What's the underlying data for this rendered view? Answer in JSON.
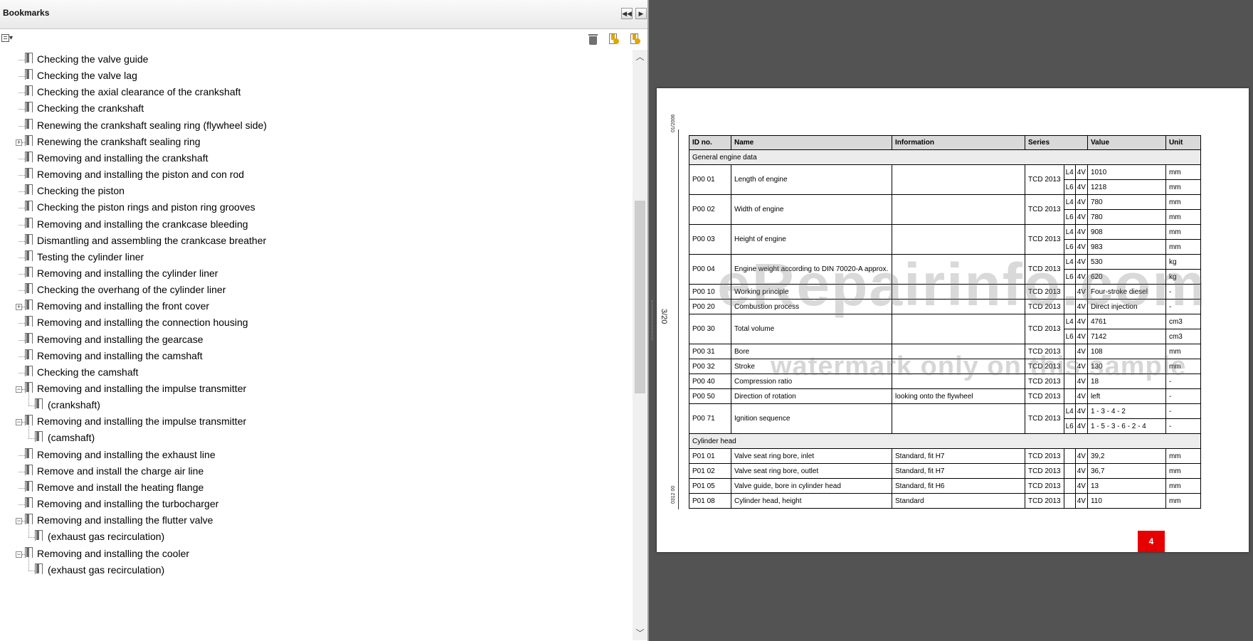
{
  "panel": {
    "title": "Bookmarks",
    "collapse_icon": "double-chevron-left-icon",
    "next_icon": "chevron-right-icon",
    "toolbar": {
      "options_icon": "options-menu-icon",
      "delete_icon": "trash-icon",
      "new_bookmark_icon": "new-bookmark-icon",
      "bookmark_properties_icon": "bookmark-properties-icon"
    },
    "bookmarks": [
      {
        "label": "Checking the valve guide",
        "expandable": false,
        "indent": 0
      },
      {
        "label": "Checking the valve lag",
        "expandable": false,
        "indent": 0
      },
      {
        "label": "Checking the axial clearance of the crankshaft",
        "expandable": false,
        "indent": 0
      },
      {
        "label": "Checking the crankshaft",
        "expandable": false,
        "indent": 0
      },
      {
        "label": "Renewing the crankshaft sealing ring (flywheel side)",
        "expandable": false,
        "indent": 0
      },
      {
        "label": "Renewing the crankshaft sealing ring",
        "expandable": true,
        "expanded": false,
        "indent": 0
      },
      {
        "label": "Removing and installing the crankshaft",
        "expandable": false,
        "indent": 0
      },
      {
        "label": "Removing and installing the piston and con rod",
        "expandable": false,
        "indent": 0
      },
      {
        "label": "Checking the piston",
        "expandable": false,
        "indent": 0
      },
      {
        "label": "Checking the piston rings and piston ring grooves",
        "expandable": false,
        "indent": 0
      },
      {
        "label": "Removing and installing the crankcase bleeding",
        "expandable": false,
        "indent": 0
      },
      {
        "label": "Dismantling and assembling the crankcase breather",
        "expandable": false,
        "indent": 0
      },
      {
        "label": "Testing the cylinder liner",
        "expandable": false,
        "indent": 0
      },
      {
        "label": "Removing and installing the cylinder liner",
        "expandable": false,
        "indent": 0
      },
      {
        "label": "Checking the overhang of the cylinder liner",
        "expandable": false,
        "indent": 0
      },
      {
        "label": "Removing and installing the front cover",
        "expandable": true,
        "expanded": false,
        "indent": 0
      },
      {
        "label": "Removing and installing the connection housing",
        "expandable": false,
        "indent": 0
      },
      {
        "label": "Removing and installing the gearcase",
        "expandable": false,
        "indent": 0
      },
      {
        "label": "Removing and installing the camshaft",
        "expandable": false,
        "indent": 0
      },
      {
        "label": "Checking the camshaft",
        "expandable": false,
        "indent": 0
      },
      {
        "label": "Removing and installing the impulse transmitter",
        "expandable": true,
        "expanded": true,
        "indent": 0
      },
      {
        "label": "(crankshaft)",
        "expandable": false,
        "indent": 1
      },
      {
        "label": "Removing and installing the impulse transmitter",
        "expandable": true,
        "expanded": true,
        "indent": 0
      },
      {
        "label": "(camshaft)",
        "expandable": false,
        "indent": 1
      },
      {
        "label": "Removing and installing the exhaust line",
        "expandable": false,
        "indent": 0
      },
      {
        "label": "Remove and install the charge air line",
        "expandable": false,
        "indent": 0
      },
      {
        "label": "Remove and install the heating flange",
        "expandable": false,
        "indent": 0
      },
      {
        "label": "Removing and installing the turbocharger",
        "expandable": false,
        "indent": 0
      },
      {
        "label": "Removing and installing the flutter valve",
        "expandable": true,
        "expanded": true,
        "indent": 0
      },
      {
        "label": "(exhaust gas recirculation)",
        "expandable": false,
        "indent": 1
      },
      {
        "label": "Removing and installing the cooler",
        "expandable": true,
        "expanded": true,
        "indent": 0
      },
      {
        "label": "(exhaust gas recirculation)",
        "expandable": false,
        "indent": 1
      }
    ]
  },
  "document": {
    "side_code_top": "01/2006",
    "side_page_number": "3/20",
    "side_code_bottom": "0312 00",
    "watermark_main": "eRepairinfo.com",
    "watermark_sub": "watermark only on this sample",
    "page_marker": "4",
    "table": {
      "headers": [
        "ID no.",
        "Name",
        "Information",
        "Series",
        "Value",
        "Unit"
      ],
      "sections": [
        {
          "title": "General engine data",
          "rows": [
            {
              "id": "P00 01",
              "name": "Length of engine",
              "info": "",
              "series": "TCD 2013",
              "variants": [
                {
                  "cyl": "L4",
                  "valves": "4V",
                  "value": "1010",
                  "unit": "mm"
                },
                {
                  "cyl": "L6",
                  "valves": "4V",
                  "value": "1218",
                  "unit": "mm"
                }
              ]
            },
            {
              "id": "P00 02",
              "name": "Width of engine",
              "info": "",
              "series": "TCD 2013",
              "variants": [
                {
                  "cyl": "L4",
                  "valves": "4V",
                  "value": "780",
                  "unit": "mm"
                },
                {
                  "cyl": "L6",
                  "valves": "4V",
                  "value": "780",
                  "unit": "mm"
                }
              ]
            },
            {
              "id": "P00 03",
              "name": "Height of engine",
              "info": "",
              "series": "TCD 2013",
              "variants": [
                {
                  "cyl": "L4",
                  "valves": "4V",
                  "value": "908",
                  "unit": "mm"
                },
                {
                  "cyl": "L6",
                  "valves": "4V",
                  "value": "983",
                  "unit": "mm"
                }
              ]
            },
            {
              "id": "P00 04",
              "name": "Engine weight according to DIN 70020-A approx.",
              "info": "",
              "series": "TCD 2013",
              "variants": [
                {
                  "cyl": "L4",
                  "valves": "4V",
                  "value": "530",
                  "unit": "kg"
                },
                {
                  "cyl": "L6",
                  "valves": "4V",
                  "value": "620",
                  "unit": "kg"
                }
              ]
            },
            {
              "id": "P00 10",
              "name": "Working principle",
              "info": "",
              "series": "TCD 2013",
              "variants": [
                {
                  "cyl": "",
                  "valves": "4V",
                  "value": "Four-stroke diesel",
                  "unit": "-"
                }
              ]
            },
            {
              "id": "P00 20",
              "name": "Combustion process",
              "info": "",
              "series": "TCD 2013",
              "variants": [
                {
                  "cyl": "",
                  "valves": "4V",
                  "value": "Direct injection",
                  "unit": "-"
                }
              ]
            },
            {
              "id": "P00 30",
              "name": "Total volume",
              "info": "",
              "series": "TCD 2013",
              "variants": [
                {
                  "cyl": "L4",
                  "valves": "4V",
                  "value": "4761",
                  "unit": "cm3"
                },
                {
                  "cyl": "L6",
                  "valves": "4V",
                  "value": "7142",
                  "unit": "cm3"
                }
              ]
            },
            {
              "id": "P00 31",
              "name": "Bore",
              "info": "",
              "series": "TCD 2013",
              "variants": [
                {
                  "cyl": "",
                  "valves": "4V",
                  "value": "108",
                  "unit": "mm"
                }
              ]
            },
            {
              "id": "P00 32",
              "name": "Stroke",
              "info": "",
              "series": "TCD 2013",
              "variants": [
                {
                  "cyl": "",
                  "valves": "4V",
                  "value": "130",
                  "unit": "mm"
                }
              ]
            },
            {
              "id": "P00 40",
              "name": "Compression ratio",
              "info": "",
              "series": "TCD 2013",
              "variants": [
                {
                  "cyl": "",
                  "valves": "4V",
                  "value": "18",
                  "unit": "-"
                }
              ]
            },
            {
              "id": "P00 50",
              "name": "Direction of rotation",
              "info": "looking onto the flywheel",
              "series": "TCD 2013",
              "variants": [
                {
                  "cyl": "",
                  "valves": "4V",
                  "value": "left",
                  "unit": "-"
                }
              ]
            },
            {
              "id": "P00 71",
              "name": "Ignition sequence",
              "info": "",
              "series": "TCD 2013",
              "variants": [
                {
                  "cyl": "L4",
                  "valves": "4V",
                  "value": "1 - 3 - 4 - 2",
                  "unit": "-"
                },
                {
                  "cyl": "L6",
                  "valves": "4V",
                  "value": "1 - 5 - 3 - 6 - 2 - 4",
                  "unit": "-"
                }
              ]
            }
          ]
        },
        {
          "title": "Cylinder head",
          "rows": [
            {
              "id": "P01 01",
              "name": "Valve seat ring bore, inlet",
              "info": "Standard, fit H7",
              "series": "TCD 2013",
              "variants": [
                {
                  "cyl": "",
                  "valves": "4V",
                  "value": "39,2",
                  "unit": "mm"
                }
              ]
            },
            {
              "id": "P01 02",
              "name": "Valve seat ring bore, outlet",
              "info": "Standard, fit H7",
              "series": "TCD 2013",
              "variants": [
                {
                  "cyl": "",
                  "valves": "4V",
                  "value": "36,7",
                  "unit": "mm"
                }
              ]
            },
            {
              "id": "P01 05",
              "name": "Valve guide, bore in cylinder head",
              "info": "Standard, fit H6",
              "series": "TCD 2013",
              "variants": [
                {
                  "cyl": "",
                  "valves": "4V",
                  "value": "13",
                  "unit": "mm"
                }
              ]
            },
            {
              "id": "P01 08",
              "name": "Cylinder head, height",
              "info": "Standard",
              "series": "TCD 2013",
              "variants": [
                {
                  "cyl": "",
                  "valves": "4V",
                  "value": "110",
                  "unit": "mm"
                }
              ]
            }
          ]
        }
      ]
    }
  }
}
